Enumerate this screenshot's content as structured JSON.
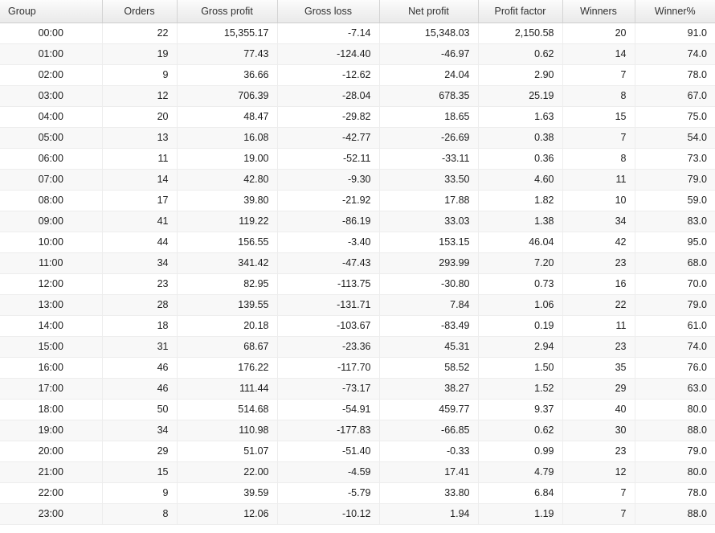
{
  "table": {
    "columns": [
      {
        "key": "group",
        "label": "Group",
        "align": "left"
      },
      {
        "key": "orders",
        "label": "Orders",
        "align": "right"
      },
      {
        "key": "gross_profit",
        "label": "Gross profit",
        "align": "right"
      },
      {
        "key": "gross_loss",
        "label": "Gross loss",
        "align": "right"
      },
      {
        "key": "net_profit",
        "label": "Net profit",
        "align": "right"
      },
      {
        "key": "profit_factor",
        "label": "Profit factor",
        "align": "right"
      },
      {
        "key": "winners",
        "label": "Winners",
        "align": "right"
      },
      {
        "key": "winner_pct",
        "label": "Winner%",
        "align": "right"
      }
    ],
    "rows": [
      {
        "group": "00:00",
        "orders": "22",
        "gross_profit": "15,355.17",
        "gross_loss": "-7.14",
        "net_profit": "15,348.03",
        "profit_factor": "2,150.58",
        "winners": "20",
        "winner_pct": "91.0"
      },
      {
        "group": "01:00",
        "orders": "19",
        "gross_profit": "77.43",
        "gross_loss": "-124.40",
        "net_profit": "-46.97",
        "profit_factor": "0.62",
        "winners": "14",
        "winner_pct": "74.0"
      },
      {
        "group": "02:00",
        "orders": "9",
        "gross_profit": "36.66",
        "gross_loss": "-12.62",
        "net_profit": "24.04",
        "profit_factor": "2.90",
        "winners": "7",
        "winner_pct": "78.0"
      },
      {
        "group": "03:00",
        "orders": "12",
        "gross_profit": "706.39",
        "gross_loss": "-28.04",
        "net_profit": "678.35",
        "profit_factor": "25.19",
        "winners": "8",
        "winner_pct": "67.0"
      },
      {
        "group": "04:00",
        "orders": "20",
        "gross_profit": "48.47",
        "gross_loss": "-29.82",
        "net_profit": "18.65",
        "profit_factor": "1.63",
        "winners": "15",
        "winner_pct": "75.0"
      },
      {
        "group": "05:00",
        "orders": "13",
        "gross_profit": "16.08",
        "gross_loss": "-42.77",
        "net_profit": "-26.69",
        "profit_factor": "0.38",
        "winners": "7",
        "winner_pct": "54.0"
      },
      {
        "group": "06:00",
        "orders": "11",
        "gross_profit": "19.00",
        "gross_loss": "-52.11",
        "net_profit": "-33.11",
        "profit_factor": "0.36",
        "winners": "8",
        "winner_pct": "73.0"
      },
      {
        "group": "07:00",
        "orders": "14",
        "gross_profit": "42.80",
        "gross_loss": "-9.30",
        "net_profit": "33.50",
        "profit_factor": "4.60",
        "winners": "11",
        "winner_pct": "79.0"
      },
      {
        "group": "08:00",
        "orders": "17",
        "gross_profit": "39.80",
        "gross_loss": "-21.92",
        "net_profit": "17.88",
        "profit_factor": "1.82",
        "winners": "10",
        "winner_pct": "59.0"
      },
      {
        "group": "09:00",
        "orders": "41",
        "gross_profit": "119.22",
        "gross_loss": "-86.19",
        "net_profit": "33.03",
        "profit_factor": "1.38",
        "winners": "34",
        "winner_pct": "83.0"
      },
      {
        "group": "10:00",
        "orders": "44",
        "gross_profit": "156.55",
        "gross_loss": "-3.40",
        "net_profit": "153.15",
        "profit_factor": "46.04",
        "winners": "42",
        "winner_pct": "95.0"
      },
      {
        "group": "11:00",
        "orders": "34",
        "gross_profit": "341.42",
        "gross_loss": "-47.43",
        "net_profit": "293.99",
        "profit_factor": "7.20",
        "winners": "23",
        "winner_pct": "68.0"
      },
      {
        "group": "12:00",
        "orders": "23",
        "gross_profit": "82.95",
        "gross_loss": "-113.75",
        "net_profit": "-30.80",
        "profit_factor": "0.73",
        "winners": "16",
        "winner_pct": "70.0"
      },
      {
        "group": "13:00",
        "orders": "28",
        "gross_profit": "139.55",
        "gross_loss": "-131.71",
        "net_profit": "7.84",
        "profit_factor": "1.06",
        "winners": "22",
        "winner_pct": "79.0"
      },
      {
        "group": "14:00",
        "orders": "18",
        "gross_profit": "20.18",
        "gross_loss": "-103.67",
        "net_profit": "-83.49",
        "profit_factor": "0.19",
        "winners": "11",
        "winner_pct": "61.0"
      },
      {
        "group": "15:00",
        "orders": "31",
        "gross_profit": "68.67",
        "gross_loss": "-23.36",
        "net_profit": "45.31",
        "profit_factor": "2.94",
        "winners": "23",
        "winner_pct": "74.0"
      },
      {
        "group": "16:00",
        "orders": "46",
        "gross_profit": "176.22",
        "gross_loss": "-117.70",
        "net_profit": "58.52",
        "profit_factor": "1.50",
        "winners": "35",
        "winner_pct": "76.0"
      },
      {
        "group": "17:00",
        "orders": "46",
        "gross_profit": "111.44",
        "gross_loss": "-73.17",
        "net_profit": "38.27",
        "profit_factor": "1.52",
        "winners": "29",
        "winner_pct": "63.0"
      },
      {
        "group": "18:00",
        "orders": "50",
        "gross_profit": "514.68",
        "gross_loss": "-54.91",
        "net_profit": "459.77",
        "profit_factor": "9.37",
        "winners": "40",
        "winner_pct": "80.0"
      },
      {
        "group": "19:00",
        "orders": "34",
        "gross_profit": "110.98",
        "gross_loss": "-177.83",
        "net_profit": "-66.85",
        "profit_factor": "0.62",
        "winners": "30",
        "winner_pct": "88.0"
      },
      {
        "group": "20:00",
        "orders": "29",
        "gross_profit": "51.07",
        "gross_loss": "-51.40",
        "net_profit": "-0.33",
        "profit_factor": "0.99",
        "winners": "23",
        "winner_pct": "79.0"
      },
      {
        "group": "21:00",
        "orders": "15",
        "gross_profit": "22.00",
        "gross_loss": "-4.59",
        "net_profit": "17.41",
        "profit_factor": "4.79",
        "winners": "12",
        "winner_pct": "80.0"
      },
      {
        "group": "22:00",
        "orders": "9",
        "gross_profit": "39.59",
        "gross_loss": "-5.79",
        "net_profit": "33.80",
        "profit_factor": "6.84",
        "winners": "7",
        "winner_pct": "78.0"
      },
      {
        "group": "23:00",
        "orders": "8",
        "gross_profit": "12.06",
        "gross_loss": "-10.12",
        "net_profit": "1.94",
        "profit_factor": "1.19",
        "winners": "7",
        "winner_pct": "88.0"
      }
    ]
  },
  "chart_data": {
    "type": "table",
    "title": "",
    "categories": [
      "00:00",
      "01:00",
      "02:00",
      "03:00",
      "04:00",
      "05:00",
      "06:00",
      "07:00",
      "08:00",
      "09:00",
      "10:00",
      "11:00",
      "12:00",
      "13:00",
      "14:00",
      "15:00",
      "16:00",
      "17:00",
      "18:00",
      "19:00",
      "20:00",
      "21:00",
      "22:00",
      "23:00"
    ],
    "series": [
      {
        "name": "Orders",
        "values": [
          22,
          19,
          9,
          12,
          20,
          13,
          11,
          14,
          17,
          41,
          44,
          34,
          23,
          28,
          18,
          31,
          46,
          46,
          50,
          34,
          29,
          15,
          9,
          8
        ]
      },
      {
        "name": "Gross profit",
        "values": [
          15355.17,
          77.43,
          36.66,
          706.39,
          48.47,
          16.08,
          19.0,
          42.8,
          39.8,
          119.22,
          156.55,
          341.42,
          82.95,
          139.55,
          20.18,
          68.67,
          176.22,
          111.44,
          514.68,
          110.98,
          51.07,
          22.0,
          39.59,
          12.06
        ]
      },
      {
        "name": "Gross loss",
        "values": [
          -7.14,
          -124.4,
          -12.62,
          -28.04,
          -29.82,
          -42.77,
          -52.11,
          -9.3,
          -21.92,
          -86.19,
          -3.4,
          -47.43,
          -113.75,
          -131.71,
          -103.67,
          -23.36,
          -117.7,
          -73.17,
          -54.91,
          -177.83,
          -51.4,
          -4.59,
          -5.79,
          -10.12
        ]
      },
      {
        "name": "Net profit",
        "values": [
          15348.03,
          -46.97,
          24.04,
          678.35,
          18.65,
          -26.69,
          -33.11,
          33.5,
          17.88,
          33.03,
          153.15,
          293.99,
          -30.8,
          7.84,
          -83.49,
          45.31,
          58.52,
          38.27,
          459.77,
          -66.85,
          -0.33,
          17.41,
          33.8,
          1.94
        ]
      },
      {
        "name": "Profit factor",
        "values": [
          2150.58,
          0.62,
          2.9,
          25.19,
          1.63,
          0.38,
          0.36,
          4.6,
          1.82,
          1.38,
          46.04,
          7.2,
          0.73,
          1.06,
          0.19,
          2.94,
          1.5,
          1.52,
          9.37,
          0.62,
          0.99,
          4.79,
          6.84,
          1.19
        ]
      },
      {
        "name": "Winners",
        "values": [
          20,
          14,
          7,
          8,
          15,
          7,
          8,
          11,
          10,
          34,
          42,
          23,
          16,
          22,
          11,
          23,
          35,
          29,
          40,
          30,
          23,
          12,
          7,
          7
        ]
      },
      {
        "name": "Winner%",
        "values": [
          91.0,
          74.0,
          78.0,
          67.0,
          75.0,
          54.0,
          73.0,
          79.0,
          59.0,
          83.0,
          95.0,
          68.0,
          70.0,
          79.0,
          61.0,
          74.0,
          76.0,
          63.0,
          80.0,
          88.0,
          79.0,
          80.0,
          78.0,
          88.0
        ]
      }
    ],
    "xlabel": "Group",
    "ylabel": "",
    "grid": true,
    "legend": "none"
  }
}
